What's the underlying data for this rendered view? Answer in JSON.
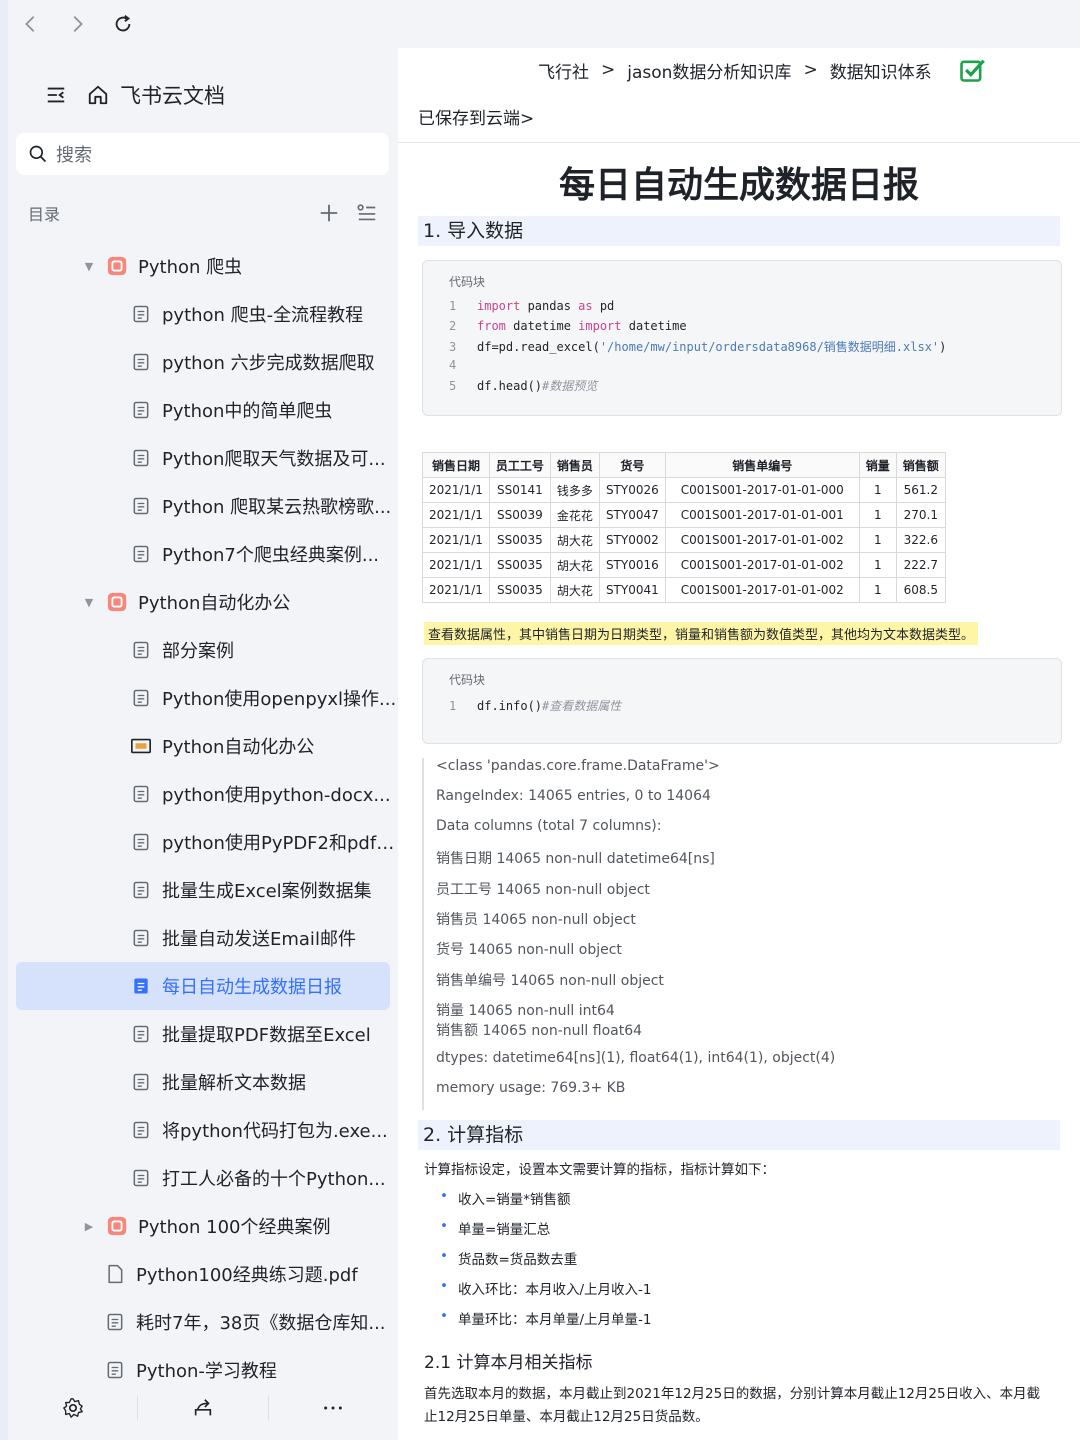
{
  "browser": {
    "back_icon": "chevron-left-icon",
    "forward_icon": "chevron-right-icon",
    "reload_icon": "reload-icon"
  },
  "sidebar": {
    "app_title": "飞书云文档",
    "search_placeholder": "搜索",
    "toc_label": "目录",
    "items": [
      {
        "label": "Python 爬虫",
        "level": 1,
        "expanded": true,
        "icon": "folder-icon"
      },
      {
        "label": "python 爬虫-全流程教程",
        "level": 2,
        "icon": "doc-icon"
      },
      {
        "label": "python 六步完成数据爬取",
        "level": 2,
        "icon": "doc-icon"
      },
      {
        "label": "Python中的简单爬虫",
        "level": 2,
        "icon": "doc-icon"
      },
      {
        "label": "Python爬取天气数据及可...",
        "level": 2,
        "icon": "doc-icon"
      },
      {
        "label": "Python 爬取某云热歌榜歌...",
        "level": 2,
        "icon": "doc-icon"
      },
      {
        "label": "Python7个爬虫经典案例...",
        "level": 2,
        "icon": "doc-icon"
      },
      {
        "label": "Python自动化办公",
        "level": 1,
        "expanded": true,
        "icon": "folder-icon"
      },
      {
        "label": "部分案例",
        "level": 2,
        "icon": "doc-icon"
      },
      {
        "label": "Python使用openpyxl操作...",
        "level": 2,
        "icon": "doc-icon"
      },
      {
        "label": "Python自动化办公",
        "level": 2,
        "icon": "slides-icon"
      },
      {
        "label": "python使用python-docx...",
        "level": 2,
        "icon": "doc-icon"
      },
      {
        "label": "python使用PyPDF2和pdfp...",
        "level": 2,
        "icon": "doc-icon"
      },
      {
        "label": "批量生成Excel案例数据集",
        "level": 2,
        "icon": "doc-icon"
      },
      {
        "label": "批量自动发送Email邮件",
        "level": 2,
        "icon": "doc-icon"
      },
      {
        "label": "每日自动生成数据日报",
        "level": 2,
        "icon": "doc-icon",
        "selected": true
      },
      {
        "label": "批量提取PDF数据至Excel",
        "level": 2,
        "icon": "doc-icon"
      },
      {
        "label": "批量解析文本数据",
        "level": 2,
        "icon": "doc-icon"
      },
      {
        "label": "将python代码打包为.exe...",
        "level": 2,
        "icon": "doc-icon"
      },
      {
        "label": "打工人必备的十个Python...",
        "level": 2,
        "icon": "doc-icon"
      },
      {
        "label": "Python 100个经典案例",
        "level": 1,
        "expanded": false,
        "icon": "folder-icon"
      },
      {
        "label": "Python100经典练习题.pdf",
        "level": 1,
        "icon": "file-icon"
      },
      {
        "label": "耗时7年，38页《数据仓库知...",
        "level": 1,
        "icon": "doc-icon"
      },
      {
        "label": "Python-学习教程",
        "level": 1,
        "icon": "doc-icon"
      }
    ]
  },
  "doc": {
    "breadcrumb": [
      "飞行社",
      "jason数据分析知识库",
      "数据知识体系"
    ],
    "breadcrumb_sep": ">",
    "saved": "已保存到云端>",
    "title": "每日自动生成数据日报",
    "h1_import": "1. 导入数据",
    "code_caption": "代码块",
    "code1": {
      "l1": "import",
      "l1b": " pandas ",
      "l1c": "as",
      "l1d": " pd",
      "l2": "from",
      "l2b": " datetime ",
      "l2c": "import",
      "l2d": " datetime",
      "l3a": "df=pd.read_excel(",
      "l3b": "'/home/mw/input/ordersdata8968/销售数据明细.xlsx'",
      "l3c": ")",
      "l5a": "df.head()",
      "l5b": "#数据预览"
    },
    "table": {
      "headers": [
        "销售日期",
        "员工工号",
        "销售员",
        "货号",
        "销售单编号",
        "销量",
        "销售额"
      ],
      "rows": [
        [
          "2021/1/1",
          "SS0141",
          "钱多多",
          "STY0026",
          "C001S001-2017-01-01-000",
          "1",
          "561.2"
        ],
        [
          "2021/1/1",
          "SS0039",
          "金花花",
          "STY0047",
          "C001S001-2017-01-01-001",
          "1",
          "270.1"
        ],
        [
          "2021/1/1",
          "SS0035",
          "胡大花",
          "STY0002",
          "C001S001-2017-01-01-002",
          "1",
          "322.6"
        ],
        [
          "2021/1/1",
          "SS0035",
          "胡大花",
          "STY0016",
          "C001S001-2017-01-01-002",
          "1",
          "222.7"
        ],
        [
          "2021/1/1",
          "SS0035",
          "胡大花",
          "STY0041",
          "C001S001-2017-01-01-002",
          "1",
          "608.5"
        ]
      ]
    },
    "highlight": "查看数据属性，其中销售日期为日期类型，销量和销售额为数值类型，其他均为文本数据类型。",
    "code2": {
      "a": "df.info()",
      "b": "#查看数据属性"
    },
    "output": [
      "<class 'pandas.core.frame.DataFrame'>",
      "RangeIndex: 14065 entries, 0 to 14064",
      "Data columns (total 7 columns):",
      "销售日期    14065 non-null datetime64[ns]",
      "员工工号    14065 non-null object",
      "销售员    14065 non-null object",
      "货号    14065 non-null object",
      "销售单编号    14065 non-null object",
      "销量    14065 non-null int64",
      "销售额    14065 non-null float64",
      "dtypes: datetime64[ns](1), float64(1), int64(1), object(4)",
      "memory usage: 769.3+ KB"
    ],
    "h1_calc": "2. 计算指标",
    "calc_intro": "计算指标设定，设置本文需要计算的指标，指标计算如下：",
    "bullets": [
      "收入=销量*销售额",
      "单量=销量汇总",
      "货品数=货品数去重",
      "收入环比：本月收入/上月收入-1",
      "单量环比：本月单量/上月单量-1"
    ],
    "h2_month": "2.1 计算本月相关指标",
    "para1": "首先选取本月的数据，本月截止到2021年12月25日的数据，分别计算本月截止12月25日收入、本月截",
    "para2": "止12月25日单量、本月截止12月25日货品数。"
  },
  "colors": {
    "accent": "#3370ff",
    "selected_bg": "#d6e2fb",
    "check": "#1aa34a",
    "heading_bg": "#edf2fc",
    "highlight": "#fff5a6"
  }
}
